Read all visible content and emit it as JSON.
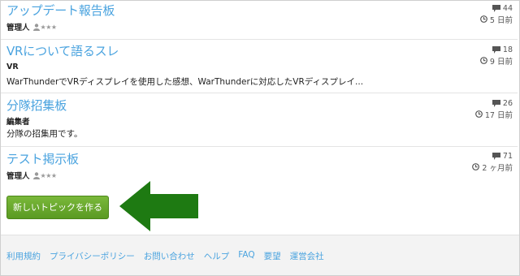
{
  "topics": [
    {
      "title": "アップデート報告板",
      "author": "管理人",
      "desc": "",
      "replies": "44",
      "age": "5 日前"
    },
    {
      "title": "VRについて語るスレ",
      "author": "VR",
      "desc": "WarThunderでVRディスプレイを使用した感想、WarThunderに対応したVRディスプレイ...",
      "replies": "18",
      "age": "9 日前"
    },
    {
      "title": "分隊招集板",
      "author": "編集者",
      "desc": "分隊の招集用です。",
      "replies": "26",
      "age": "17 日前"
    },
    {
      "title": "テスト掲示板",
      "author": "管理人",
      "desc": "",
      "replies": "71",
      "age": "2 ヶ月前"
    }
  ],
  "rank_stars": "★★★",
  "new_topic_button": "新しいトピックを作る",
  "footer_links": [
    "利用規約",
    "プライバシーポリシー",
    "お問い合わせ",
    "ヘルプ",
    "FAQ",
    "要望",
    "運営会社"
  ],
  "colors": {
    "link": "#4aa3df",
    "button": "#6aab2e",
    "arrow": "#1e7a12"
  },
  "icons": {
    "replies": "comment-icon",
    "age": "clock-icon",
    "rank": "person-icon"
  }
}
